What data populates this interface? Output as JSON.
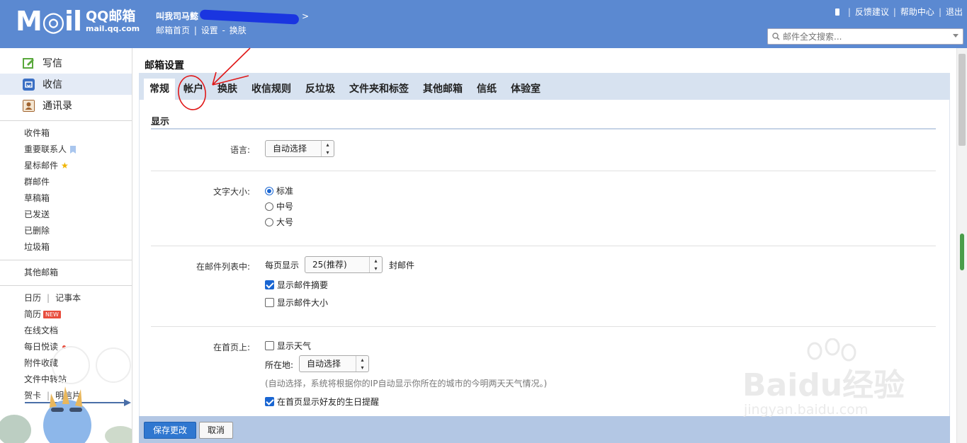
{
  "header": {
    "logo_main": "M◎il",
    "logo_brand": "QQ邮箱",
    "logo_domain": "mail.qq.com",
    "user_name": "叫我司马懿",
    "links": [
      "邮箱首页",
      "设置",
      "换肤"
    ],
    "top_right": [
      "反馈建议",
      "帮助中心",
      "退出"
    ],
    "search_placeholder": "邮件全文搜索..."
  },
  "sidebar": {
    "main_nav": [
      {
        "label": "写信",
        "icon": "compose-icon",
        "color": "#59a83c"
      },
      {
        "label": "收信",
        "icon": "inbox-icon",
        "color": "#3a6fc4"
      },
      {
        "label": "通讯录",
        "icon": "contacts-icon",
        "color": "#a0622d"
      }
    ],
    "folders": [
      "收件箱",
      "重要联系人",
      "星标邮件",
      "群邮件",
      "草稿箱",
      "已发送",
      "已删除",
      "垃圾箱"
    ],
    "other_mail": "其他邮箱",
    "tools": {
      "calendar": "日历",
      "notes": "记事本",
      "resume": "简历",
      "resume_tag": "NEW",
      "online_docs": "在线文档",
      "daily_read": "每日悦读",
      "attachments": "附件收藏",
      "transfer": "文件中转站",
      "card": "贺卡",
      "postcard": "明信片"
    }
  },
  "main": {
    "title": "邮箱设置",
    "tabs": [
      "常规",
      "帐户",
      "换肤",
      "收信规则",
      "反垃圾",
      "文件夹和标签",
      "其他邮箱",
      "信纸",
      "体验室"
    ],
    "active_tab": "常规",
    "section_title": "显示",
    "language": {
      "label": "语言:",
      "value": "自动选择"
    },
    "font_size": {
      "label": "文字大小:",
      "options": [
        "标准",
        "中号",
        "大号"
      ],
      "selected": "标准"
    },
    "mail_list": {
      "label": "在邮件列表中:",
      "per_page_prefix": "每页显示",
      "per_page_value": "25(推荐)",
      "per_page_suffix": "封邮件",
      "show_summary": "显示邮件摘要",
      "show_summary_checked": true,
      "show_size": "显示邮件大小",
      "show_size_checked": false
    },
    "homepage": {
      "label": "在首页上:",
      "show_weather": "显示天气",
      "show_weather_checked": false,
      "location_label": "所在地:",
      "location_value": "自动选择",
      "hint": "(自动选择，系统将根据你的IP自动显示你所在的城市的今明两天天气情况。)",
      "birthday": "在首页显示好友的生日提醒",
      "birthday_checked": true
    },
    "buttons": {
      "save": "保存更改",
      "cancel": "取消"
    }
  },
  "watermark": {
    "brand": "Baidu经验",
    "url": "jingyan.baidu.com"
  }
}
